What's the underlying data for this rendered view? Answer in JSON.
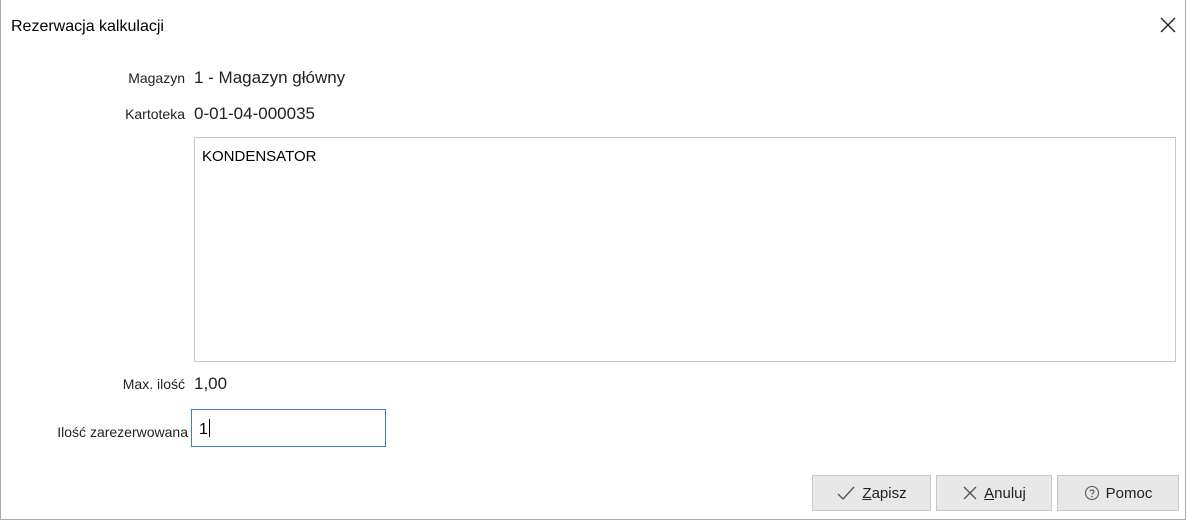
{
  "window": {
    "title": "Rezerwacja kalkulacji"
  },
  "fields": {
    "magazyn_label": "Magazyn",
    "magazyn_value": "1 - Magazyn główny",
    "kartoteka_label": "Kartoteka",
    "kartoteka_value": "0-01-04-000035",
    "description": "KONDENSATOR",
    "max_label": "Max. ilość",
    "max_value": "1,00",
    "qty_label": "Ilość zarezerwowana",
    "qty_value": "1"
  },
  "buttons": {
    "save_first": "Z",
    "save_rest": "apisz",
    "cancel_first": "A",
    "cancel_rest": "nuluj",
    "help": "Pomoc"
  },
  "icons": {
    "save": "check-icon",
    "cancel": "x-icon",
    "help": "help-circle-icon",
    "close": "close-icon"
  },
  "colors": {
    "focus_border": "#3d7ad8",
    "button_bg": "#e8e8e8"
  }
}
